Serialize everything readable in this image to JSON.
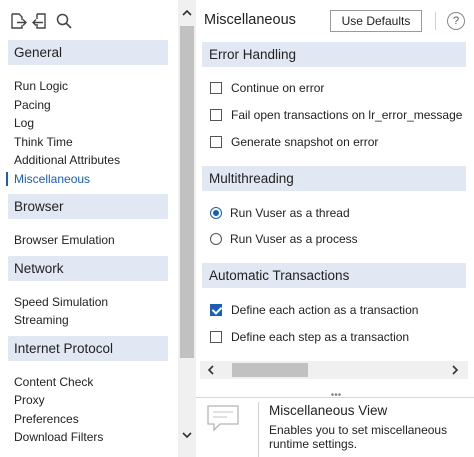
{
  "toolbar": {
    "icons": [
      "export-icon",
      "import-icon",
      "search-icon"
    ]
  },
  "sidebar": {
    "groups": [
      {
        "header": "General",
        "items": [
          "Run Logic",
          "Pacing",
          "Log",
          "Think Time",
          "Additional Attributes",
          "Miscellaneous"
        ]
      },
      {
        "header": "Browser",
        "items": [
          "Browser Emulation"
        ]
      },
      {
        "header": "Network",
        "items": [
          "Speed Simulation",
          "Streaming"
        ]
      },
      {
        "header": "Internet Protocol",
        "items": [
          "Content Check",
          "Proxy",
          "Preferences",
          "Download Filters"
        ]
      }
    ],
    "selected_item": "Miscellaneous"
  },
  "panel": {
    "title": "Miscellaneous",
    "use_defaults_label": "Use Defaults",
    "help_label": "?"
  },
  "error_handling": {
    "header": "Error Handling",
    "options": [
      {
        "label": "Continue on error",
        "checked": false
      },
      {
        "label": "Fail open transactions on lr_error_message",
        "checked": false
      },
      {
        "label": "Generate snapshot on error",
        "checked": false
      }
    ]
  },
  "multithreading": {
    "header": "Multithreading",
    "options": [
      {
        "label": "Run Vuser as a thread",
        "selected": true
      },
      {
        "label": "Run Vuser as a process",
        "selected": false
      }
    ]
  },
  "automatic_transactions": {
    "header": "Automatic Transactions",
    "options": [
      {
        "label": "Define each action as a transaction",
        "checked": true
      },
      {
        "label": "Define each step as a transaction",
        "checked": false
      }
    ]
  },
  "info": {
    "title": "Miscellaneous View",
    "description": "Enables you to set miscellaneous runtime settings."
  },
  "colors": {
    "section_bg": "#e1e8f3",
    "accent": "#1a5fb4"
  }
}
